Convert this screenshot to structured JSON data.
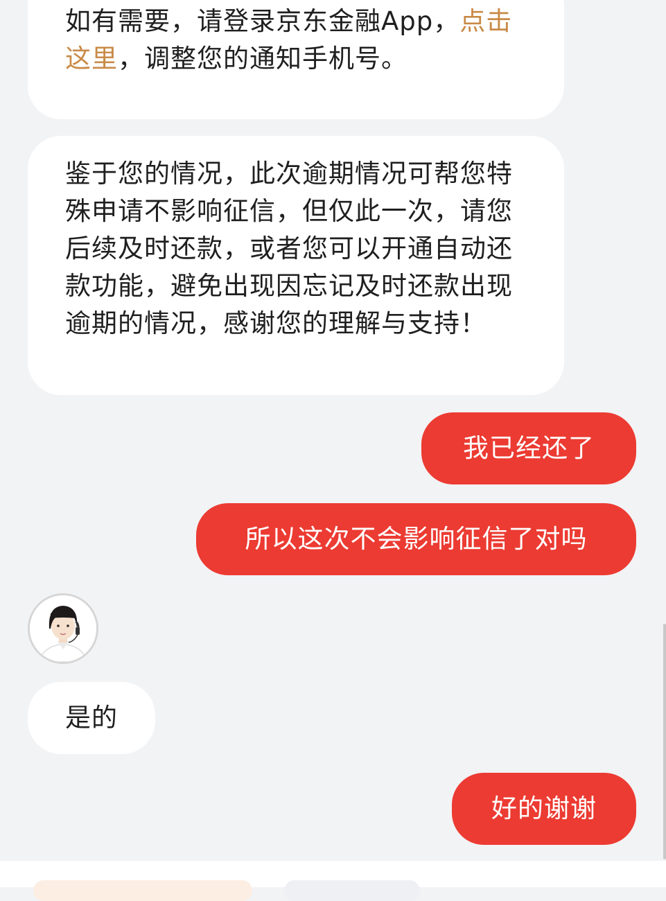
{
  "messages": {
    "m1": {
      "text_before": "如有需要，请登录京东金融App，",
      "link": "点击这里",
      "text_after": "，调整您的通知手机号。"
    },
    "m2": {
      "text": "鉴于您的情况，此次逾期情况可帮您特殊申请不影响征信，但仅此一次，请您后续及时还款，或者您可以开通自动还款功能，避免出现因忘记及时还款出现逾期的情况，感谢您的理解与支持！"
    },
    "m3": {
      "text": "我已经还了"
    },
    "m4": {
      "text": "所以这次不会影响征信了对吗"
    },
    "m5": {
      "text": "是的"
    },
    "m6": {
      "text": "好的谢谢"
    }
  },
  "agent": {
    "avatar_icon": "agent-headset-avatar"
  },
  "colors": {
    "outgoing_bubble": "#ec3b32",
    "incoming_bubble": "#ffffff",
    "link": "#c98a47",
    "background": "#f2f3f5"
  }
}
